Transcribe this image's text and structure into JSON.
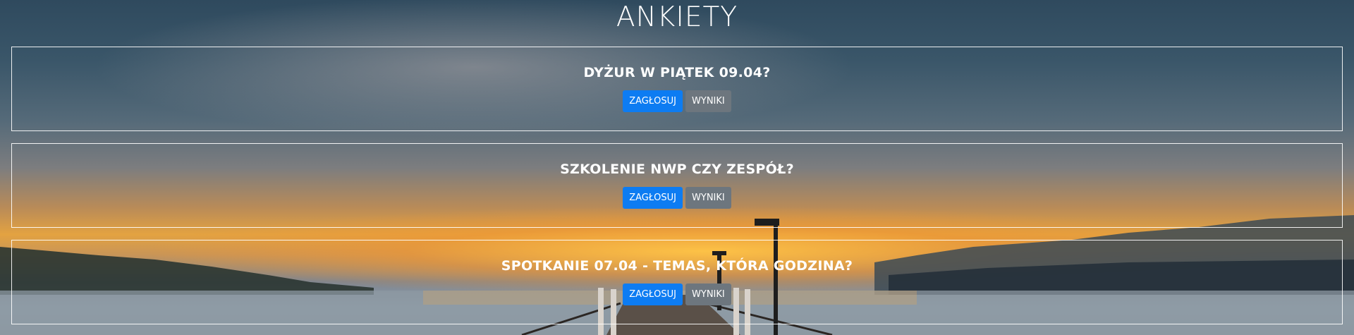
{
  "page": {
    "title": "ANKIETY"
  },
  "polls": [
    {
      "question": "DYŻUR W PIĄTEK 09.04?",
      "vote_label": "ZAGŁOSUJ",
      "results_label": "WYNIKI"
    },
    {
      "question": "SZKOLENIE NWP CZY ZESPÓŁ?",
      "vote_label": "ZAGŁOSUJ",
      "results_label": "WYNIKI"
    },
    {
      "question": "SPOTKANIE 07.04 - TEMAS, KTÓRA GODZINA?",
      "vote_label": "ZAGŁOSUJ",
      "results_label": "WYNIKI"
    }
  ],
  "colors": {
    "vote_button": "#0d7cf2",
    "results_button": "#6d767e",
    "border": "#ffffff"
  }
}
